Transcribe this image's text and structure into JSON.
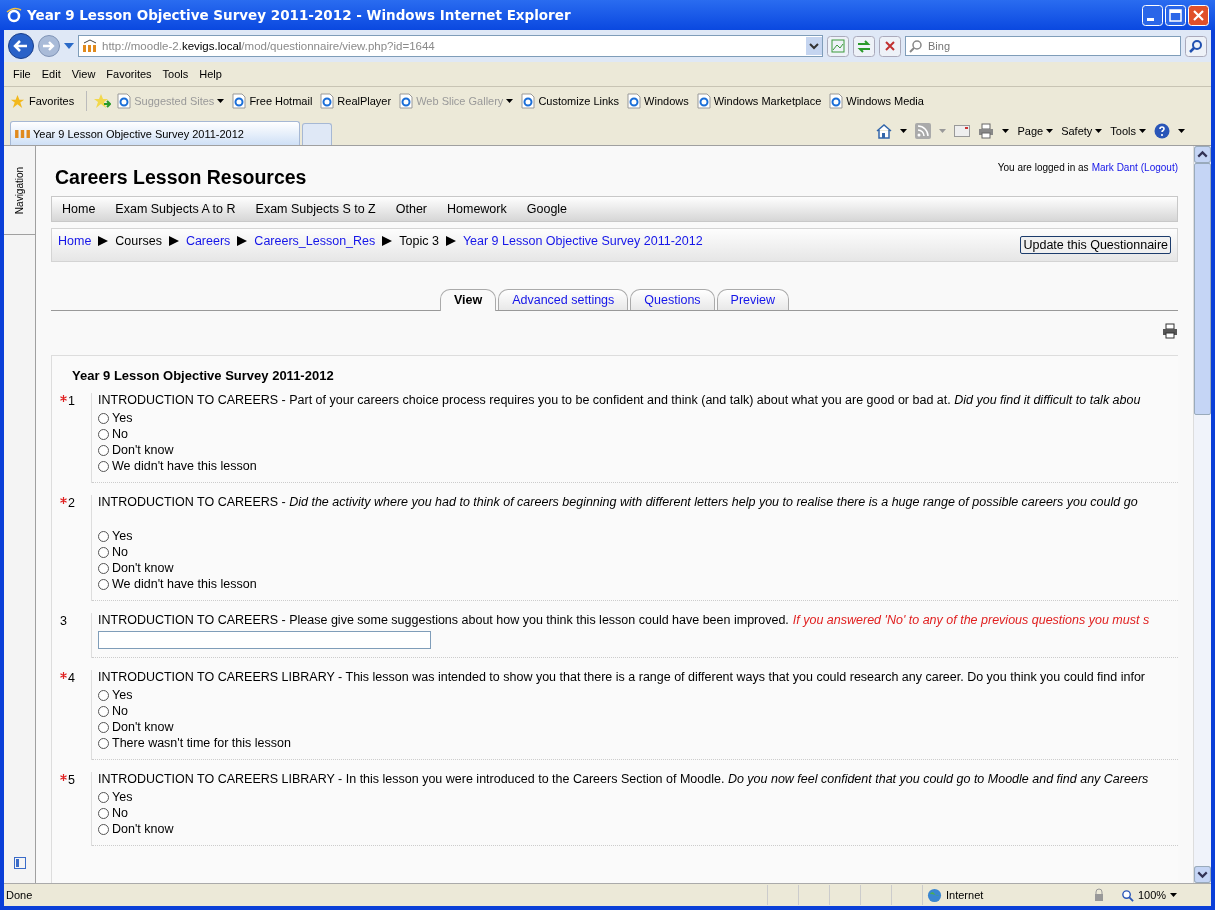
{
  "window": {
    "title": "Year 9 Lesson Objective Survey 2011-2012 - Windows Internet Explorer"
  },
  "address": {
    "prefix": "http://moodle-2.",
    "host": "kevigs.local",
    "path": "/mod/questionnaire/view.php?id=1644"
  },
  "search": {
    "placeholder": "Bing"
  },
  "menu": [
    "File",
    "Edit",
    "View",
    "Favorites",
    "Tools",
    "Help"
  ],
  "favorites": {
    "label": "Favorites",
    "links": [
      {
        "label": "Suggested Sites",
        "disabled": true,
        "dropdown": true
      },
      {
        "label": "Free Hotmail",
        "disabled": false,
        "dropdown": false
      },
      {
        "label": "RealPlayer",
        "disabled": false,
        "dropdown": false
      },
      {
        "label": "Web Slice Gallery",
        "disabled": true,
        "dropdown": true
      },
      {
        "label": "Customize Links",
        "disabled": false,
        "dropdown": false
      },
      {
        "label": "Windows",
        "disabled": false,
        "dropdown": false
      },
      {
        "label": "Windows Marketplace",
        "disabled": false,
        "dropdown": false
      },
      {
        "label": "Windows Media",
        "disabled": false,
        "dropdown": false
      }
    ]
  },
  "browser_tab": {
    "title": "Year 9 Lesson Objective Survey 2011-2012"
  },
  "command_bar": [
    "Page",
    "Safety",
    "Tools"
  ],
  "sidebar": {
    "label": "Navigation"
  },
  "page": {
    "site_title": "Careers Lesson Resources",
    "login": {
      "prefix": "You are logged in as",
      "user": "Mark Dant",
      "logout": "(Logout)"
    },
    "nav": [
      "Home",
      "Exam Subjects A to R",
      "Exam Subjects S to Z",
      "Other",
      "Homework",
      "Google"
    ],
    "breadcrumb": [
      {
        "label": "Home",
        "link": true
      },
      {
        "label": "Courses",
        "link": false
      },
      {
        "label": "Careers",
        "link": true
      },
      {
        "label": "Careers_Lesson_Res",
        "link": true
      },
      {
        "label": "Topic 3",
        "link": false
      },
      {
        "label": "Year 9 Lesson Objective Survey 2011-2012",
        "link": true
      }
    ],
    "update_button": "Update this Questionnaire",
    "tabs": [
      {
        "label": "View",
        "selected": true
      },
      {
        "label": "Advanced settings",
        "selected": false
      },
      {
        "label": "Questions",
        "selected": false
      },
      {
        "label": "Preview",
        "selected": false
      }
    ],
    "survey_title": "Year 9 Lesson Objective Survey 2011-2012",
    "questions": [
      {
        "number": "1",
        "required": true,
        "kind": "radio",
        "text": "INTRODUCTION TO CAREERS - Part of your careers choice process requires you to be confident and think (and talk) about what you are good or bad at. *Did you find it difficult to talk abou*",
        "gap": false,
        "options": [
          {
            "label": "Yes",
            "selected": false
          },
          {
            "label": "No",
            "selected": false
          },
          {
            "label": "Don't know",
            "selected": false
          },
          {
            "label": "We didn't have this lesson",
            "selected": false
          }
        ]
      },
      {
        "number": "2",
        "required": true,
        "kind": "radio",
        "text": "INTRODUCTION TO CAREERS - *Did the activity where you had to think of careers beginning with different letters help you to realise there is a huge range of possible careers you could go*",
        "gap": true,
        "options": [
          {
            "label": "Yes",
            "selected": false
          },
          {
            "label": "No",
            "selected": false
          },
          {
            "label": "Don't know",
            "selected": false
          },
          {
            "label": "We didn't have this lesson",
            "selected": false
          }
        ]
      },
      {
        "number": "3",
        "required": false,
        "kind": "text",
        "text": "INTRODUCTION TO CAREERS - Please give some suggestions about how you think this lesson could have been improved.",
        "note": "If you answered 'No' to any of the previous questions you must s"
      },
      {
        "number": "4",
        "required": true,
        "kind": "radio",
        "text": "INTRODUCTION TO CAREERS LIBRARY - This lesson was intended to show you that there is a range of different ways that you could research any career. Do you think you could find infor",
        "gap": false,
        "options": [
          {
            "label": "Yes",
            "selected": false
          },
          {
            "label": "No",
            "selected": false
          },
          {
            "label": "Don't know",
            "selected": false
          },
          {
            "label": "There wasn't time for this lesson",
            "selected": false
          }
        ]
      },
      {
        "number": "5",
        "required": true,
        "kind": "radio",
        "text": "INTRODUCTION TO CAREERS  LIBRARY - In this lesson you were introduced to the Careers Section of Moodle. *Do you now feel confident that you could go to Moodle and find any Careers*",
        "gap": false,
        "options": [
          {
            "label": "Yes",
            "selected": false
          },
          {
            "label": "No",
            "selected": false
          },
          {
            "label": "Don't know",
            "selected": false
          }
        ]
      }
    ]
  },
  "status_bar": {
    "text": "Done",
    "zone": "Internet",
    "zoom": "100%"
  }
}
